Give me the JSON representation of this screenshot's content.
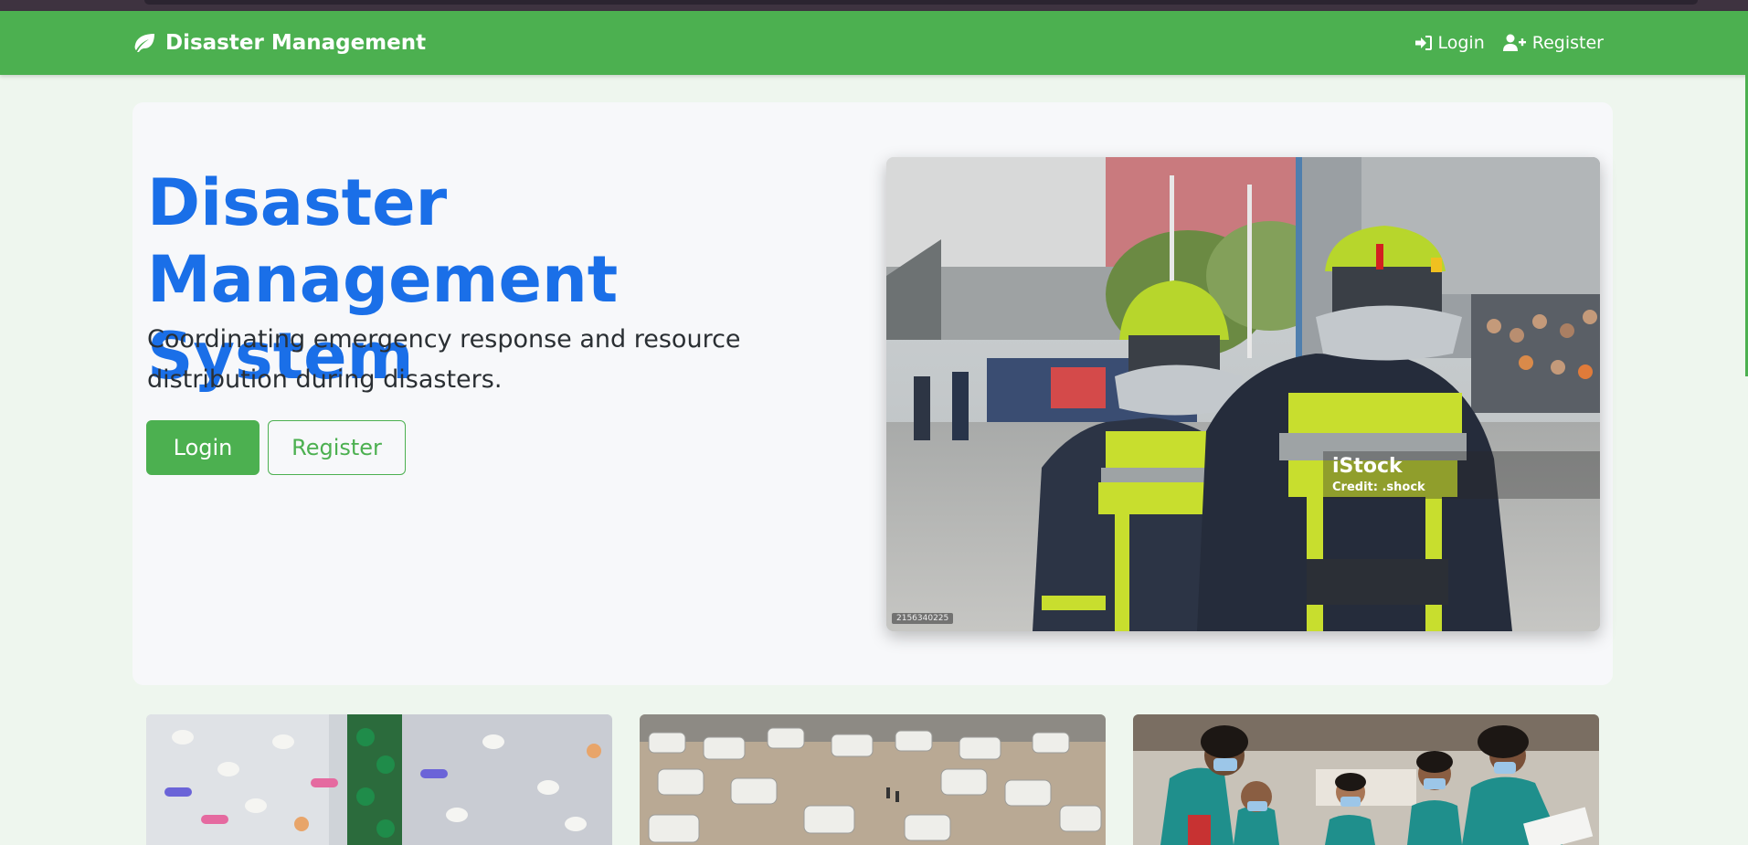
{
  "navbar": {
    "brand_icon": "leaf-icon",
    "brand": "Disaster Management",
    "login_icon": "sign-in-icon",
    "login": "Login",
    "register_icon": "user-plus-icon",
    "register": "Register",
    "color": "#4cb050"
  },
  "hero": {
    "title": "Disaster Management System",
    "subtitle": "Coordinating emergency response and resource distribution during disasters.",
    "login_button": "Login",
    "register_button": "Register",
    "title_color": "#1a6fe8",
    "image": {
      "watermark_brand": "iStock",
      "watermark_credit": "Credit: .shock",
      "stock_id": "2156340225"
    }
  },
  "cards": [
    {
      "image": "medicine-pills-image"
    },
    {
      "image": "relief-camp-tents-image"
    },
    {
      "image": "medical-volunteers-image"
    }
  ]
}
